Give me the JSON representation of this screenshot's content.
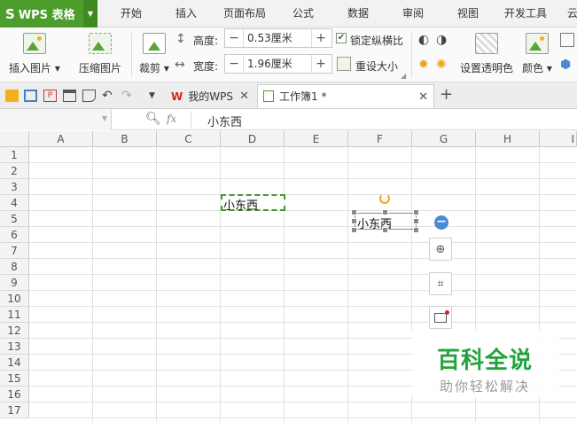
{
  "app": {
    "logo": "S",
    "name": "WPS 表格"
  },
  "menu": [
    "开始",
    "插入",
    "页面布局",
    "公式",
    "数据",
    "审阅",
    "视图",
    "开发工具",
    "云"
  ],
  "ribbon": {
    "insert_picture": "插入图片",
    "compress_picture": "压缩图片",
    "crop": "裁剪",
    "height_label": "高度:",
    "height_value": "0.53厘米",
    "width_label": "宽度:",
    "width_value": "1.96厘米",
    "lock_ratio": "锁定纵横比",
    "lock_ratio_checked": true,
    "reset_size": "重设大小",
    "set_transparent": "设置透明色",
    "color": "颜色"
  },
  "tabs": [
    {
      "label": "我的WPS",
      "active": false
    },
    {
      "label": "工作簿1 *",
      "active": true
    }
  ],
  "formula": {
    "fx": "fx",
    "content": "小东西"
  },
  "sheet": {
    "columns": [
      "A",
      "B",
      "C",
      "D",
      "E",
      "F",
      "G",
      "H",
      "I"
    ],
    "rows": [
      "1",
      "2",
      "3",
      "4",
      "5",
      "6",
      "7",
      "8",
      "9",
      "10",
      "11",
      "12",
      "13",
      "14",
      "15",
      "16",
      "17"
    ],
    "cell_D4": "小东西",
    "picture_text": "小东西"
  },
  "watermark": {
    "main": "百科全说",
    "sub": "助你轻松解决"
  },
  "colors": {
    "accent": "#4c9d2c",
    "marquee": "#3c9e27"
  }
}
